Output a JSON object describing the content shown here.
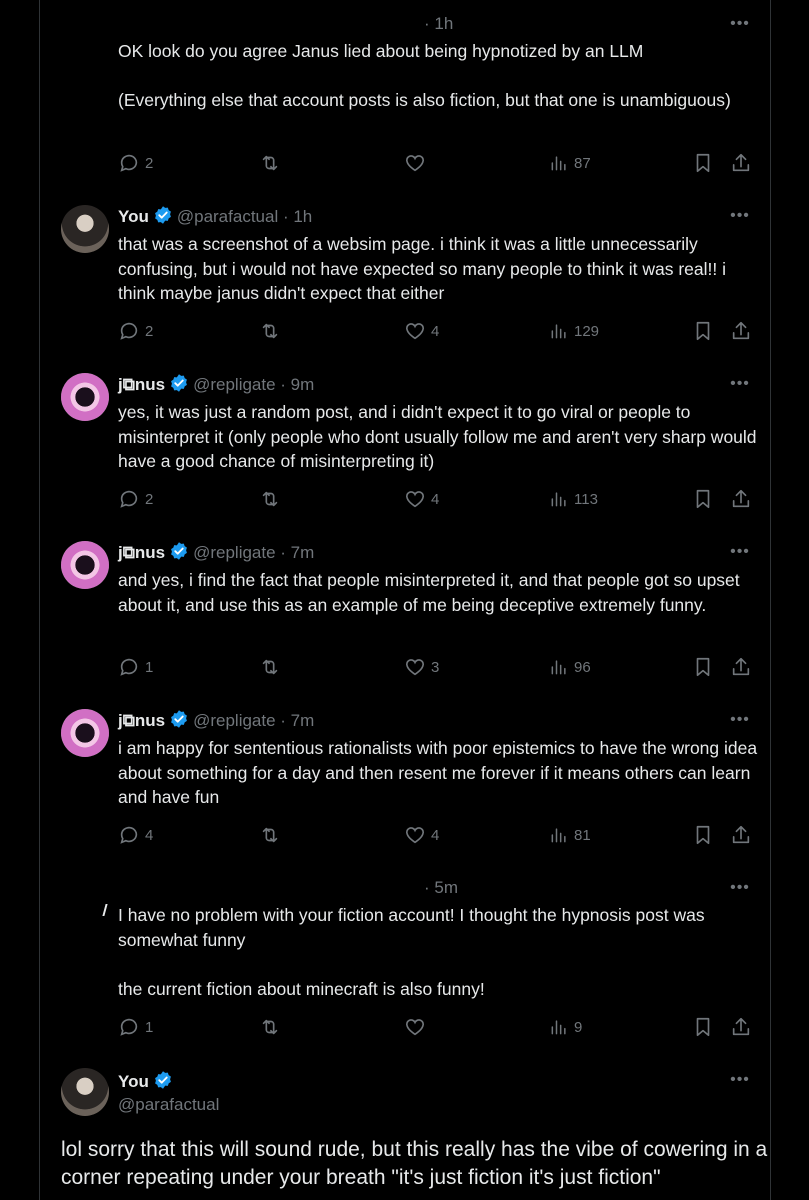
{
  "tweets": [
    {
      "time": "· 1h",
      "text": "OK look do you agree Janus lied about being hypnotized by an LLM\n\n(Everything else that account posts is also fiction, but that one is unambiguous)",
      "replies": "2",
      "retweets": "",
      "likes": "",
      "views": "87"
    },
    {
      "name": "You",
      "handle": "@parafactual",
      "time": "· 1h",
      "text": "that was a screenshot of a websim page. i think it was a little unnecessarily confusing, but i would not have expected so many people to think it was real!! i think maybe janus didn't expect that either",
      "replies": "2",
      "retweets": "",
      "likes": "4",
      "views": "129"
    },
    {
      "name": "j⧉nus",
      "handle": "@repligate",
      "time": "· 9m",
      "text": "yes, it was just a random post, and i didn't expect it to go viral or people to misinterpret it (only people who dont usually follow me and aren't very sharp would have a good chance of misinterpreting it)",
      "replies": "2",
      "retweets": "",
      "likes": "4",
      "views": "113"
    },
    {
      "name": "j⧉nus",
      "handle": "@repligate",
      "time": "· 7m",
      "text": "and yes, i find the fact that people misinterpreted it, and that people got so upset about it, and use this as an example of me being deceptive extremely funny.",
      "replies": "1",
      "retweets": "",
      "likes": "3",
      "views": "96"
    },
    {
      "name": "j⧉nus",
      "handle": "@repligate",
      "time": "· 7m",
      "text": "i am happy for sententious rationalists with poor epistemics to have the wrong idea about something for a day and then resent me forever if it means others can learn and have fun",
      "replies": "4",
      "retweets": "",
      "likes": "4",
      "views": "81"
    },
    {
      "time": "· 5m",
      "text": "I have no problem with your fiction account! I thought the hypnosis post was somewhat funny\n\nthe current fiction about minecraft is also funny!",
      "replies": "1",
      "retweets": "",
      "likes": "",
      "views": "9"
    }
  ],
  "main_tweet": {
    "name": "You",
    "handle": "@parafactual",
    "text": "lol sorry that this will sound rude, but this really has the vibe of cowering in a corner repeating under your breath \"it's just fiction it's just fiction\""
  },
  "colors": {
    "background": "#000000",
    "text": "#e7e9ea",
    "muted": "#71767b",
    "verified": "#1d9bf0",
    "border": "#2f3336"
  },
  "icons": [
    "reply-icon",
    "retweet-icon",
    "like-icon",
    "views-icon",
    "bookmark-icon",
    "share-icon",
    "more-icon",
    "verified-badge-icon"
  ]
}
